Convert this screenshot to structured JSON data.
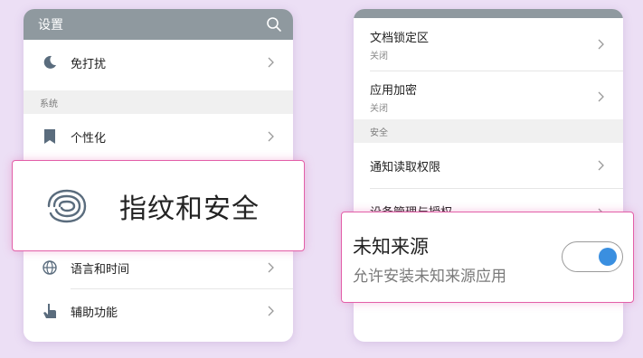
{
  "left_phone": {
    "title": "设置",
    "dnd_label": "免打扰",
    "section_system": "系统",
    "personalize_label": "个性化",
    "language_label": "语言和时间",
    "accessibility_label": "辅助功能"
  },
  "fingerprint_popup": {
    "label": "指纹和安全"
  },
  "right_phone": {
    "doc_lock_title": "文档锁定区",
    "doc_lock_status": "关闭",
    "app_encrypt_title": "应用加密",
    "app_encrypt_status": "关闭",
    "section_security": "安全",
    "notification_access_label": "通知读取权限",
    "device_admin_label": "设备管理与授权"
  },
  "unknown_sources_popup": {
    "title": "未知来源",
    "subtitle": "允许安装未知来源应用",
    "toggle_on": true,
    "toggle_color": "#3a8fe0"
  },
  "colors": {
    "titlebar": "#8f999f",
    "background": "#ecdff5",
    "highlight_border": "#e35fa8"
  }
}
